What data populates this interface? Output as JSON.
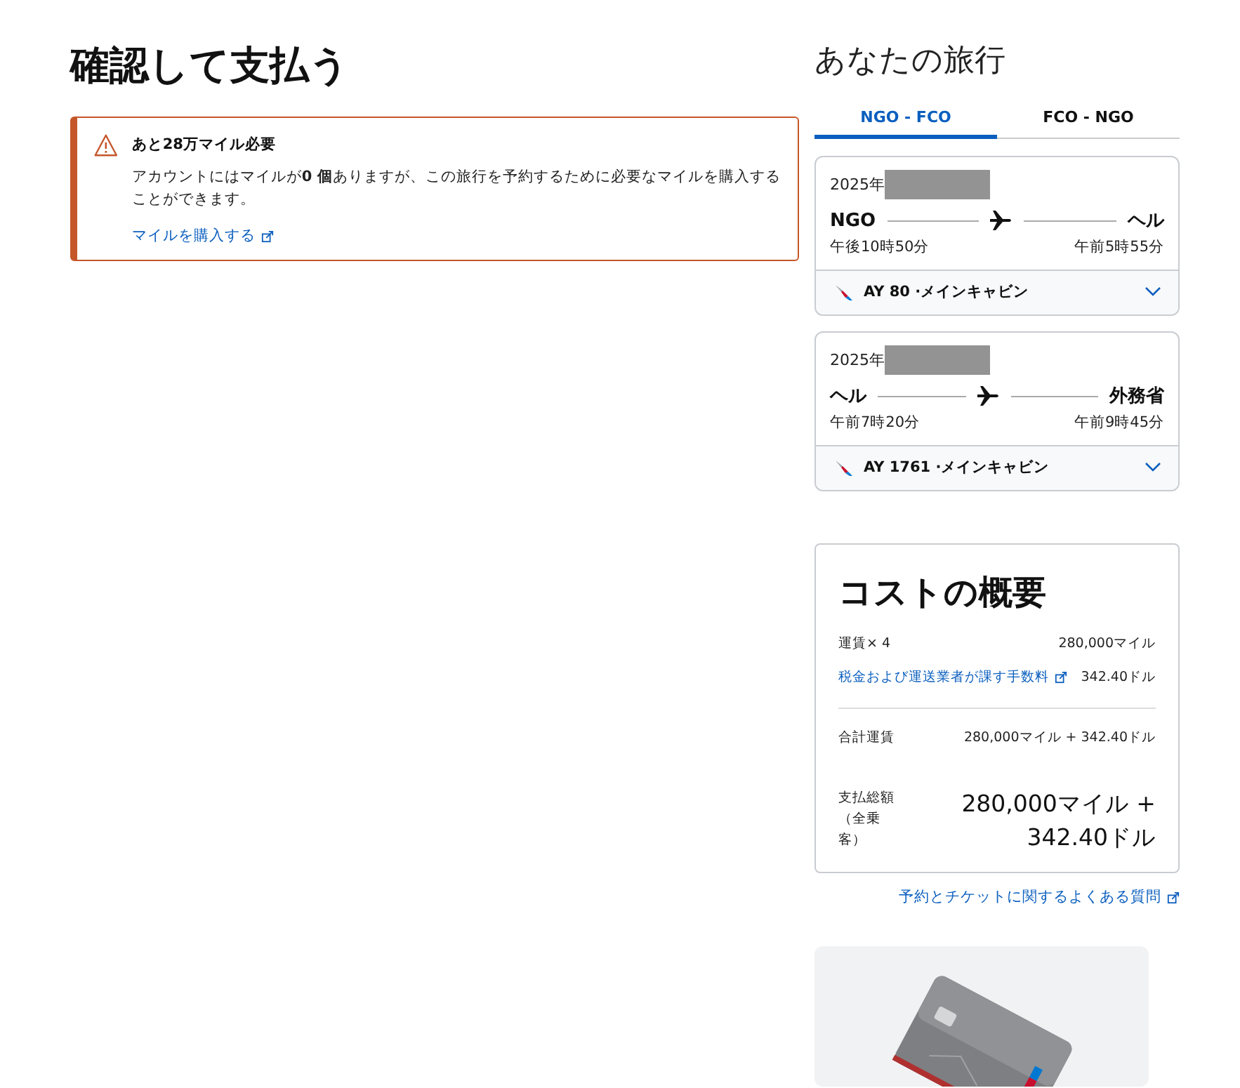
{
  "page_title": "確認して支払う",
  "alert": {
    "title": "あと28万マイル必要",
    "message": "アカウントにはマイルが**0 個**ありますが、この旅行を予約するために必要なマイルを購入することができます。",
    "link": "マイルを購入する"
  },
  "trip": {
    "title": "あなたの旅行",
    "tabs": [
      {
        "label": "NGO - FCO",
        "selected": true
      },
      {
        "label": "FCO - NGO",
        "selected": false
      }
    ],
    "flights": [
      {
        "date": "2025年",
        "origin": "NGO",
        "destination": "ヘル",
        "departure": "午後10時50分",
        "arrival": "午前5時55分",
        "flight": "AY 80 ·メインキャビン",
        "expanded": false
      },
      {
        "date": "2025年",
        "origin": "ヘル",
        "destination": "外務省",
        "departure": "午前7時20分",
        "arrival": "午前9時45分",
        "flight": "AY 1761 ·メインキャビン",
        "expanded": false
      }
    ]
  },
  "cost": {
    "title": "コストの概要",
    "rows": [
      {
        "kind": "text",
        "label": "運賃× 4",
        "value": "280,000マイル"
      },
      {
        "kind": "link",
        "label": "税金および運送業者が課す手数料",
        "value": "342.40ドル"
      }
    ],
    "subtotal": {
      "label": "合計運賃",
      "value": "280,000マイル + 342.40ドル"
    },
    "total": {
      "label": "支払総額（全乗客）",
      "value": "280,000マイル + 342.40ドル"
    }
  },
  "faq_link": "予約とチケットに関するよくある質問"
}
